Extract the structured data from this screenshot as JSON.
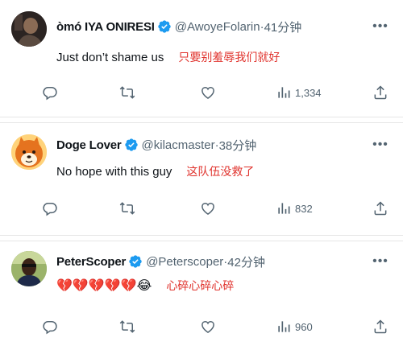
{
  "tweets": [
    {
      "name": "òmó IYA ONIRESI",
      "handle": "@AwoyeFolarin",
      "time": "41分钟",
      "text": "Just don’t shame us",
      "translation": "只要别羞辱我们就好",
      "views": "1,334",
      "avatar_color": "#3a2e2a"
    },
    {
      "name": "Doge Lover",
      "handle": "@kilacmaster",
      "time": "38分钟",
      "text": "No hope with this guy",
      "translation": "这队伍没救了",
      "views": "832",
      "avatar_color": "#e5731f"
    },
    {
      "name": "PeterScoper",
      "handle": "@Peterscoper",
      "time": "42分钟",
      "text": "💔💔💔💔💔😂",
      "translation": "心碎心碎心碎",
      "views": "960",
      "avatar_color": "#6b8a3f"
    }
  ],
  "separator": " · ",
  "icons": {
    "verified": "verified-badge-icon",
    "more": "more-icon",
    "reply": "reply-icon",
    "retweet": "retweet-icon",
    "like": "like-icon",
    "views": "views-icon",
    "share": "share-icon"
  },
  "colors": {
    "verified": "#1d9bf0",
    "translation": "#e0322c",
    "muted": "#536471"
  }
}
